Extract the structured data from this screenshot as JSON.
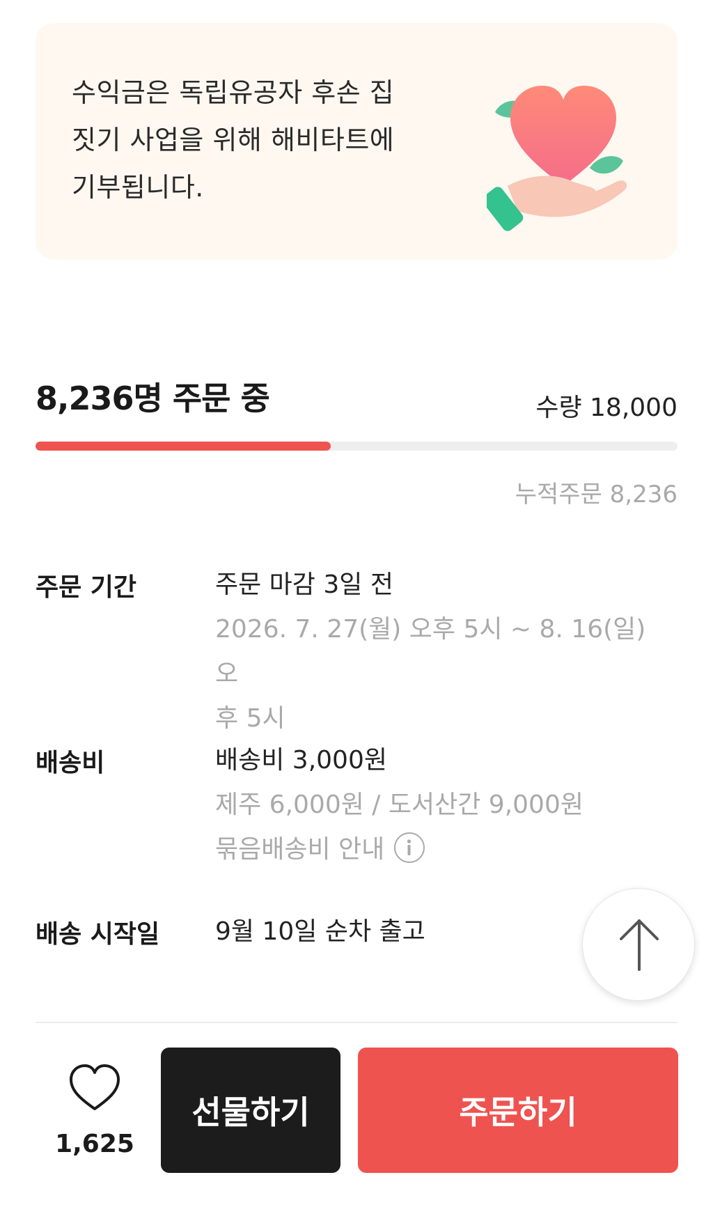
{
  "banner": {
    "lines": [
      "수익금은 독립유공자 후손 집",
      "짓기 사업을 위해 해비타트에",
      "기부됩니다."
    ],
    "icon": "heart-hand-icon"
  },
  "order_status": {
    "count_text": "8,236명 주문 중",
    "quantity_text": "수량 18,000",
    "progress_percent": 46,
    "cumulative_text": "누적주문 8,236"
  },
  "details": {
    "period": {
      "label": "주문 기간",
      "main": "주문 마감 3일 전",
      "sub_line1": "2026. 7. 27(월) 오후 5시 ~ 8. 16(일) 오",
      "sub_line2": "후 5시"
    },
    "shipping_fee": {
      "label": "배송비",
      "main": "배송비 3,000원",
      "sub": "제주 6,000원 / 도서산간 9,000원",
      "bundle_info": "묶음배송비 안내",
      "info_icon": "info-icon"
    },
    "ship_start": {
      "label": "배송 시작일",
      "main": "9월 10일 순차 출고"
    }
  },
  "scroll_top": {
    "icon": "arrow-up-icon"
  },
  "bottom_bar": {
    "like_icon": "heart-outline-icon",
    "like_count": "1,625",
    "gift_label": "선물하기",
    "order_label": "주문하기"
  },
  "colors": {
    "accent": "#ee5350",
    "banner_bg": "#fff8f1",
    "gift_bg": "#1c1c1c",
    "muted_text": "#a9a9a9"
  }
}
